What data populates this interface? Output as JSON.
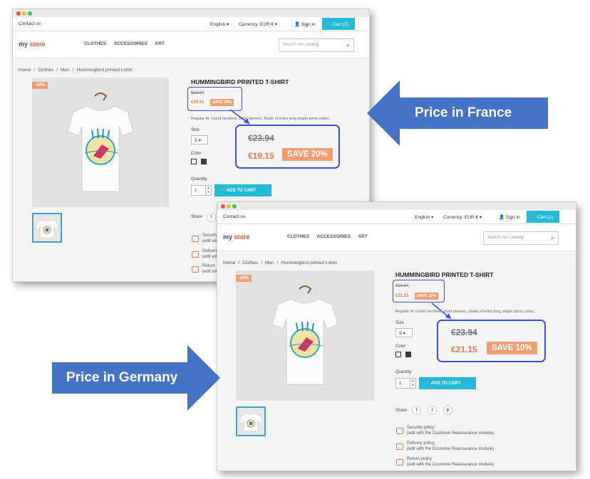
{
  "store": {
    "contact": "Contact us",
    "language": "English ▾",
    "currency": "Currency: EUR € ▾",
    "signin": "Sign in",
    "cart": "Cart (2)",
    "logo_my": "my",
    "logo_store": "store",
    "nav": [
      "CLOTHES",
      "ACCESSORIES",
      "ART"
    ],
    "search_placeholder": "Search our catalog",
    "breadcrumb": [
      "Home",
      "Clothes",
      "Men",
      "Hummingbird printed t-shirt"
    ],
    "product_name": "HUMMINGBIRD PRINTED T-SHIRT",
    "description": "Regular fit, round neckline, short sleeves. Made of extra long staple pima cotton.",
    "size_label": "Size",
    "size_value": "S",
    "color_label": "Color",
    "quantity_label": "Quantity",
    "quantity_value": "1",
    "add_to_cart": "ADD TO CART",
    "share_label": "Share",
    "policies": [
      {
        "title": "Security policy",
        "sub": "(edit with the Customer Reassurance module)"
      },
      {
        "title": "Delivery policy",
        "sub": "(edit with the Customer Reassurance module)"
      },
      {
        "title": "Return policy",
        "sub": "(edit with the Customer Reassurance module)"
      }
    ]
  },
  "france": {
    "discount_badge": "-20%",
    "old_price": "€23.94",
    "new_price": "€19.15",
    "save_label": "SAVE 20%",
    "callout": "Price in France"
  },
  "germany": {
    "old_price": "€23.94",
    "new_price": "€21.15",
    "save_label": "SAVE 10%",
    "callout": "Price in Germany"
  },
  "colors": {
    "accent": "#24b9d7",
    "price": "#e67c55",
    "save_badge": "#f39d72",
    "highlight_border": "#3d4fd4",
    "callout_arrow": "#4472c4"
  }
}
